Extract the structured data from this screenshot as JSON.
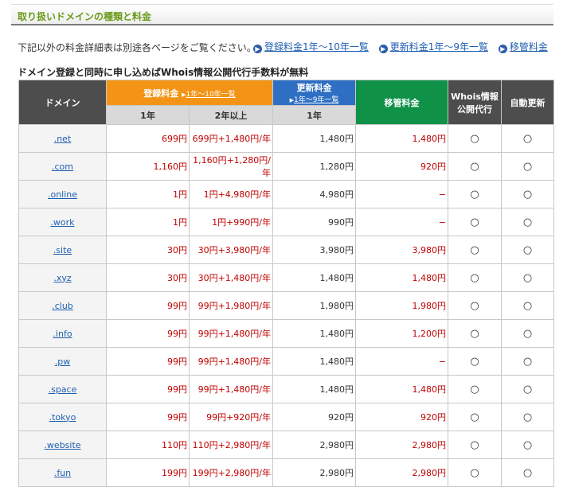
{
  "section_title": "取り扱いドメインの種類と料金",
  "intro_text": "下記以外の料金詳細表は別途各ページをご覧ください。",
  "links": [
    {
      "label": "登録料金1年〜10年一覧"
    },
    {
      "label": "更新料金1年〜9年一覧"
    },
    {
      "label": "移管料金"
    }
  ],
  "note": "ドメイン登録と同時に申し込めばWhois情報公開代行手数料が無料",
  "table": {
    "headers": {
      "domain": "ドメイン",
      "register": "登録料金",
      "register_link": "1年〜10年一覧",
      "renew": "更新料金",
      "renew_link": "1年〜9年一覧",
      "transfer": "移管料金",
      "whois": "Whois情報公開代行",
      "auto_renew": "自動更新",
      "sub_1y": "1年",
      "sub_2y": "2年以上",
      "sub_renew_1y": "1年"
    },
    "rows": [
      {
        "name": ".net",
        "reg1": "699円",
        "reg2": "699円+1,480円/年",
        "renew": "1,480円",
        "transfer": "1,480円",
        "whois": "○",
        "auto": "○"
      },
      {
        "name": ".com",
        "reg1": "1,160円",
        "reg2": "1,160円+1,280円/年",
        "renew": "1,280円",
        "transfer": "920円",
        "whois": "○",
        "auto": "○"
      },
      {
        "name": ".online",
        "reg1": "1円",
        "reg2": "1円+4,980円/年",
        "renew": "4,980円",
        "transfer": "−",
        "whois": "○",
        "auto": "○"
      },
      {
        "name": ".work",
        "reg1": "1円",
        "reg2": "1円+990円/年",
        "renew": "990円",
        "transfer": "−",
        "whois": "○",
        "auto": "○"
      },
      {
        "name": ".site",
        "reg1": "30円",
        "reg2": "30円+3,980円/年",
        "renew": "3,980円",
        "transfer": "3,980円",
        "whois": "○",
        "auto": "○"
      },
      {
        "name": ".xyz",
        "reg1": "30円",
        "reg2": "30円+1,480円/年",
        "renew": "1,480円",
        "transfer": "1,480円",
        "whois": "○",
        "auto": "○"
      },
      {
        "name": ".club",
        "reg1": "99円",
        "reg2": "99円+1,980円/年",
        "renew": "1,980円",
        "transfer": "1,980円",
        "whois": "○",
        "auto": "○"
      },
      {
        "name": ".info",
        "reg1": "99円",
        "reg2": "99円+1,480円/年",
        "renew": "1,480円",
        "transfer": "1,200円",
        "whois": "○",
        "auto": "○"
      },
      {
        "name": ".pw",
        "reg1": "99円",
        "reg2": "99円+1,480円/年",
        "renew": "1,480円",
        "transfer": "−",
        "whois": "○",
        "auto": "○"
      },
      {
        "name": ".space",
        "reg1": "99円",
        "reg2": "99円+1,480円/年",
        "renew": "1,480円",
        "transfer": "1,480円",
        "whois": "○",
        "auto": "○"
      },
      {
        "name": ".tokyo",
        "reg1": "99円",
        "reg2": "99円+920円/年",
        "renew": "920円",
        "transfer": "920円",
        "whois": "○",
        "auto": "○"
      },
      {
        "name": ".website",
        "reg1": "110円",
        "reg2": "110円+2,980円/年",
        "renew": "2,980円",
        "transfer": "2,980円",
        "whois": "○",
        "auto": "○"
      },
      {
        "name": ".fun",
        "reg1": "199円",
        "reg2": "199円+2,980円/年",
        "renew": "2,980円",
        "transfer": "2,980円",
        "whois": "○",
        "auto": "○"
      }
    ]
  }
}
